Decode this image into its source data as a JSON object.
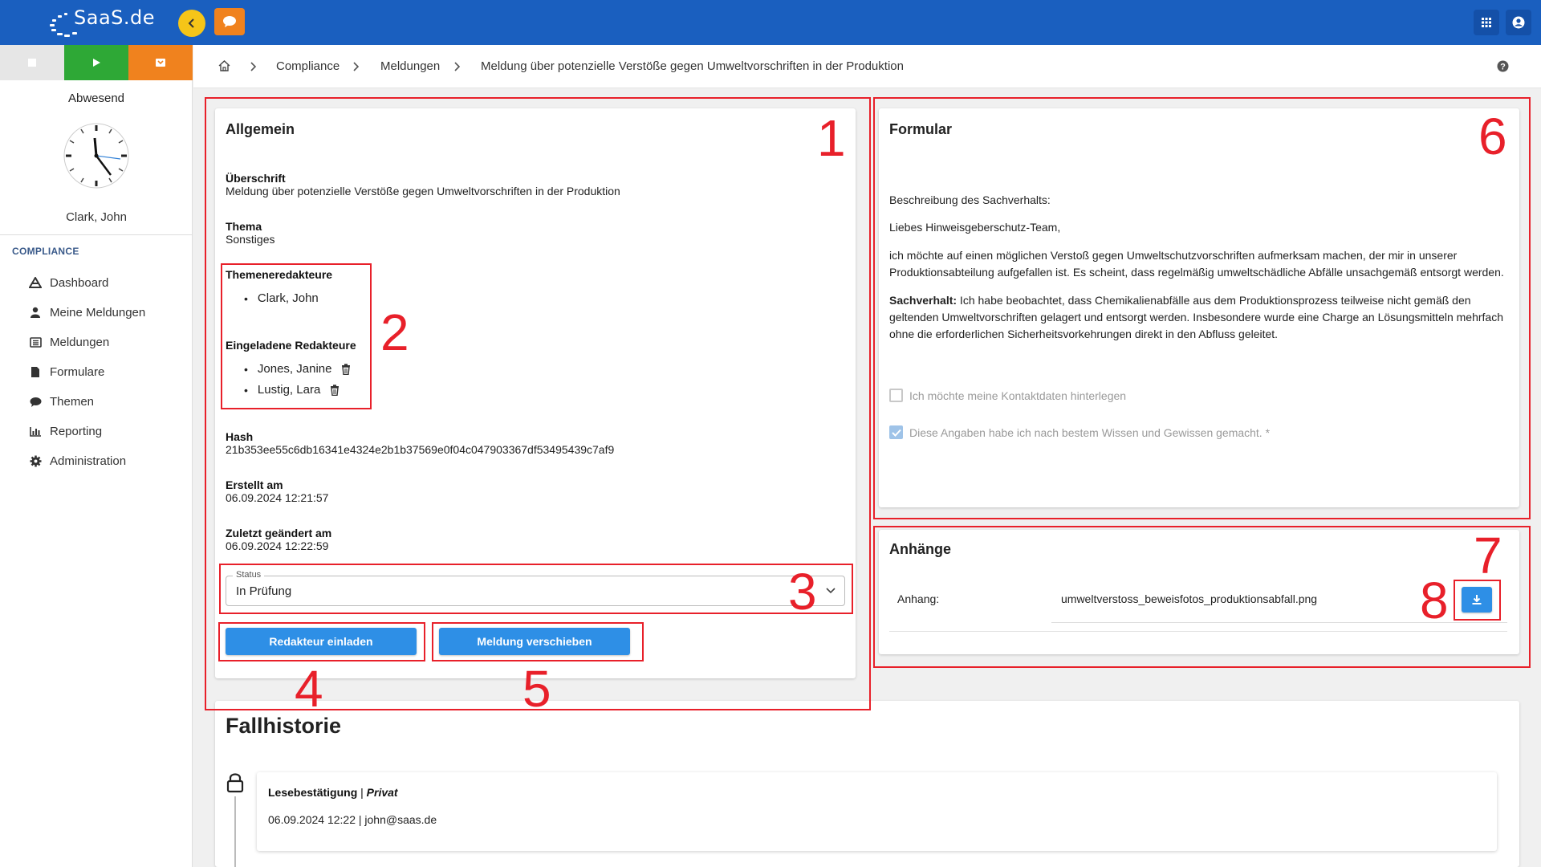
{
  "app": {
    "logo_text": "SaaS.de"
  },
  "sidebar": {
    "status": "Abwesend",
    "user": "Clark, John",
    "section": "COMPLIANCE",
    "items": [
      {
        "label": "Dashboard",
        "icon": "dashboard-icon"
      },
      {
        "label": "Meine Meldungen",
        "icon": "person-icon"
      },
      {
        "label": "Meldungen",
        "icon": "inbox-icon"
      },
      {
        "label": "Formulare",
        "icon": "file-icon"
      },
      {
        "label": "Themen",
        "icon": "chat-icon"
      },
      {
        "label": "Reporting",
        "icon": "bar-chart-icon"
      },
      {
        "label": "Administration",
        "icon": "gear-icon"
      }
    ]
  },
  "breadcrumb": {
    "items": [
      "Compliance",
      "Meldungen",
      "Meldung über potenzielle Verstöße gegen Umweltvorschriften in der Produktion"
    ]
  },
  "allgemein": {
    "title": "Allgemein",
    "ueberschrift_label": "Überschrift",
    "ueberschrift_value": "Meldung über potenzielle Verstöße gegen Umweltvorschriften in der Produktion",
    "thema_label": "Thema",
    "thema_value": "Sonstiges",
    "themenredakteure_label": "Themeneredakteure",
    "themenredakteure": [
      "Clark, John"
    ],
    "eingeladene_label": "Eingeladene Redakteure",
    "eingeladene": [
      "Jones, Janine",
      "Lustig, Lara"
    ],
    "hash_label": "Hash",
    "hash_value": "21b353ee55c6db16341e4324e2b1b37569e0f04c047903367df53495439c7af9",
    "erstellt_label": "Erstellt am",
    "erstellt_value": "06.09.2024 12:21:57",
    "geaendert_label": "Zuletzt geändert am",
    "geaendert_value": "06.09.2024 12:22:59",
    "status_label": "Status",
    "status_value": "In Prüfung",
    "btn_invite": "Redakteur einladen",
    "btn_move": "Meldung verschieben"
  },
  "formular": {
    "title": "Formular",
    "line1": "Beschreibung des Sachverhalts:",
    "line2": "Liebes Hinweisgeberschutz-Team,",
    "para1": "ich möchte auf einen möglichen Verstoß gegen Umweltschutzvorschriften aufmerksam machen, der mir in unserer Produktionsabteilung aufgefallen ist. Es scheint, dass regelmäßig umweltschädliche Abfälle unsachgemäß entsorgt werden.",
    "para2_bold": "Sachverhalt:",
    "para2": " Ich habe beobachtet, dass Chemikalienabfälle aus dem Produktionsprozess teilweise nicht gemäß den geltenden Umweltvorschriften gelagert und entsorgt werden. Insbesondere wurde eine Charge an Lösungsmitteln mehrfach ohne die erforderlichen Sicherheitsvorkehrungen direkt in den Abfluss geleitet.",
    "chk1": "Ich möchte meine Kontaktdaten hinterlegen",
    "chk2": "Diese Angaben habe ich nach bestem Wissen und Gewissen gemacht. *"
  },
  "anhaenge": {
    "title": "Anhänge",
    "label": "Anhang:",
    "file": "umweltverstoss_beweisfotos_produktionsabfall.png"
  },
  "historie": {
    "title": "Fallhistorie",
    "entry_title": "Lesebestätigung",
    "entry_sep": " | ",
    "entry_tag": "Privat",
    "entry_meta": "06.09.2024 12:22 | john@saas.de"
  },
  "annotations": [
    "1",
    "2",
    "3",
    "4",
    "5",
    "6",
    "7",
    "8"
  ],
  "colors": {
    "topbar": "#1a5fbf",
    "accent_blue": "#2e8fe6",
    "green": "#2ea836",
    "orange": "#f0821e",
    "annotation_red": "#e8202a"
  }
}
